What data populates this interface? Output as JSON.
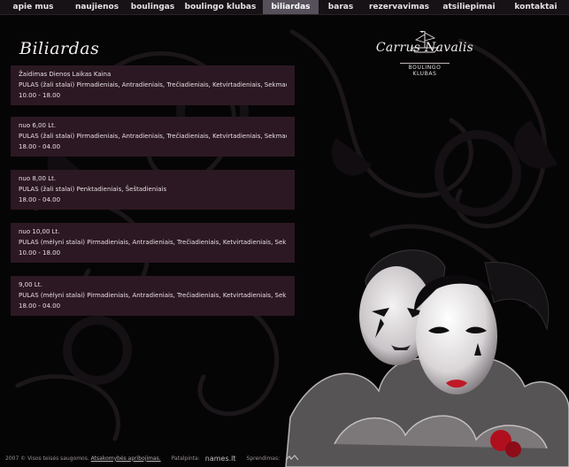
{
  "nav": {
    "items": [
      {
        "label": "apie mus",
        "active": false
      },
      {
        "label": "naujienos",
        "active": false
      },
      {
        "label": "boulingas",
        "active": false
      },
      {
        "label": "boulingo klubas",
        "active": false
      },
      {
        "label": "biliardas",
        "active": true
      },
      {
        "label": "baras",
        "active": false
      },
      {
        "label": "rezervavimas",
        "active": false
      },
      {
        "label": "atsiliepimai",
        "active": false
      },
      {
        "label": "kontaktai",
        "active": false
      }
    ]
  },
  "page": {
    "title": "Biliardas"
  },
  "logo": {
    "name": "Carrus Navalis",
    "subtitle": "BOULINGO KLUBAS"
  },
  "price_blocks": [
    {
      "lines": [
        "Žaidimas Dienos Laikas Kaina",
        "PULAS (žali stalai) Pirmadieniais, Antradieniais, Trečiadieniais, Ketvirtadieniais, Sekmadieniais",
        "10.00 - 18.00"
      ]
    },
    {
      "lines": [
        "nuo 6,00 Lt.",
        "PULAS (žali stalai) Pirmadieniais, Antradieniais, Trečiadieniais, Ketvirtadieniais, Sekmadieniais",
        "18.00 - 04.00"
      ]
    },
    {
      "lines": [
        "nuo 8,00 Lt.",
        "PULAS (žali stalai) Penktadieniais, Šeštadieniais",
        "18.00 - 04.00"
      ]
    },
    {
      "lines": [
        "nuo 10,00 Lt.",
        "PULAS (mėlyni stalai) Pirmadieniais, Antradieniais, Trečiadieniais, Ketvirtadieniais, Sekmadieniais",
        "10.00 - 18.00"
      ]
    },
    {
      "lines": [
        "9,00 Lt.",
        "PULAS (mėlyni stalai) Pirmadieniais, Antradieniais, Trečiadieniais, Ketvirtadieniais, Sekmadieniais",
        "18.00 - 04.00"
      ]
    }
  ],
  "footer": {
    "copyright": "2007 © Visos teisės saugomos.",
    "policy_link": "Atsakomybės apribojimas.",
    "host_label": "Patalpinta:",
    "host_name": "names.lt",
    "design_label": "Sprendimas:"
  }
}
